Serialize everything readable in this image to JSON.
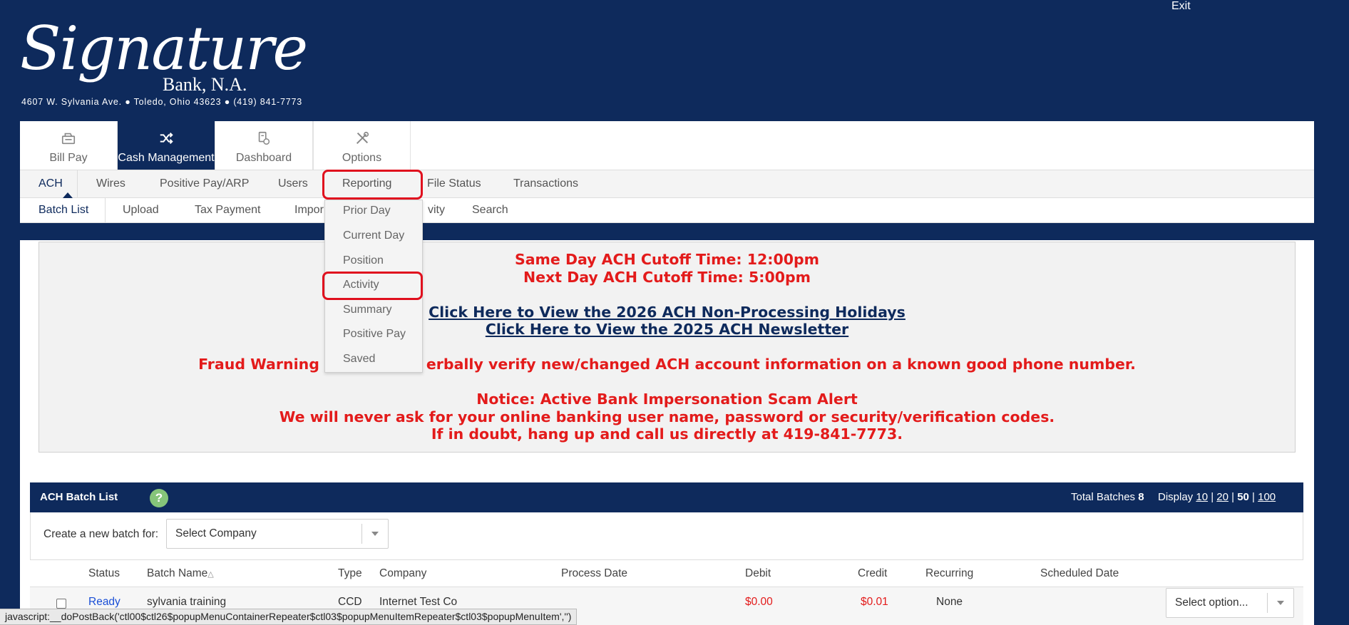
{
  "header": {
    "exit_label": "Exit",
    "logo_script": "Signature",
    "logo_bank": "Bank, N.A.",
    "logo_address": "4607 W. Sylvania Ave.  ●  Toledo, Ohio 43623  ●  (419) 841-7773"
  },
  "top_tabs": [
    {
      "label": "Bill Pay",
      "icon": "bill-pay-icon"
    },
    {
      "label": "Cash Management",
      "icon": "shuffle-icon",
      "active": true
    },
    {
      "label": "Dashboard",
      "icon": "dashboard-icon"
    },
    {
      "label": "Options",
      "icon": "tools-icon"
    }
  ],
  "nav1": [
    "ACH",
    "Wires",
    "Positive Pay/ARP",
    "Users",
    "Reporting",
    "File Status",
    "Transactions"
  ],
  "nav2": [
    "Batch List",
    "Upload",
    "Tax Payment",
    "Impor",
    "vity",
    "Search"
  ],
  "reporting_menu": [
    "Prior Day",
    "Current Day",
    "Position",
    "Activity",
    "Summary",
    "Positive Pay",
    "Saved"
  ],
  "notice": {
    "line1": "Same Day ACH Cutoff Time: 12:00pm",
    "line2": "Next Day ACH Cutoff Time: 5:00pm",
    "link1": "Click Here to View the 2026 ACH Non-Processing Holidays",
    "link2": "Click Here to View the 2025 ACH Newsletter",
    "fraud_a": "Fraud Warning",
    "fraud_b": "erbally verify new/changed ACH account information on a known good phone number.",
    "notice1": "Notice: Active Bank Impersonation Scam Alert",
    "notice2": "We will never ask for your online banking user name, password or security/verification codes.",
    "notice3": "If in doubt, hang up and call us directly at 419-841-7773."
  },
  "batch": {
    "title": "ACH Batch List",
    "total_label": "Total Batches",
    "total_value": "8",
    "display_label": "Display",
    "display_options": [
      "10",
      "20",
      "50",
      "100"
    ],
    "create_label": "Create a new batch for:",
    "company_select": "Select Company",
    "columns": [
      "Status",
      "Batch Name",
      "Type",
      "Company",
      "Process Date",
      "Debit",
      "Credit",
      "Recurring",
      "Scheduled Date"
    ],
    "rows": [
      {
        "status": "Ready",
        "name": "sylvania training",
        "type": "CCD",
        "company": "Internet Test Co",
        "debit": "$0.00",
        "credit": "$0.01",
        "recurring": "None",
        "action": "Select option..."
      }
    ]
  },
  "statusbar": "javascript:__doPostBack('ctl00$ctl26$popupMenuContainerRepeater$ctl03$popupMenuItemRepeater$ctl03$popupMenuItem','')",
  "colors": {
    "navy": "#0e2a5c",
    "alert_red": "#e31b1b",
    "highlight_red": "#e0101e"
  }
}
